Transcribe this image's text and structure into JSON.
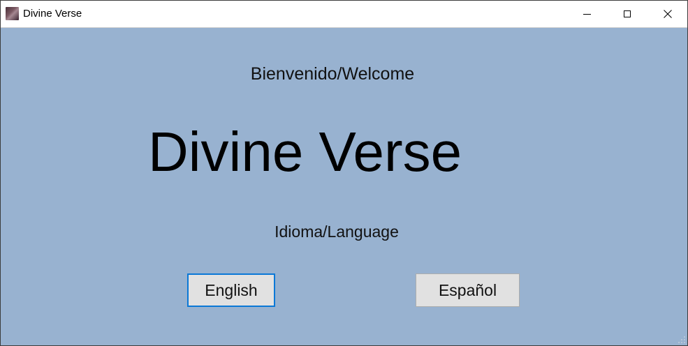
{
  "window": {
    "title": "Divine Verse",
    "minimize_icon": "minimize-icon",
    "maximize_icon": "maximize-icon",
    "close_icon": "close-icon"
  },
  "main": {
    "welcome_text": "Bienvenido/Welcome",
    "app_title": "Divine Verse",
    "language_label": "Idioma/Language",
    "buttons": {
      "english": "English",
      "spanish": "Español"
    }
  },
  "colors": {
    "background": "#98b2d0",
    "button_bg": "#e1e1e1",
    "focus_border": "#0a78d7"
  }
}
